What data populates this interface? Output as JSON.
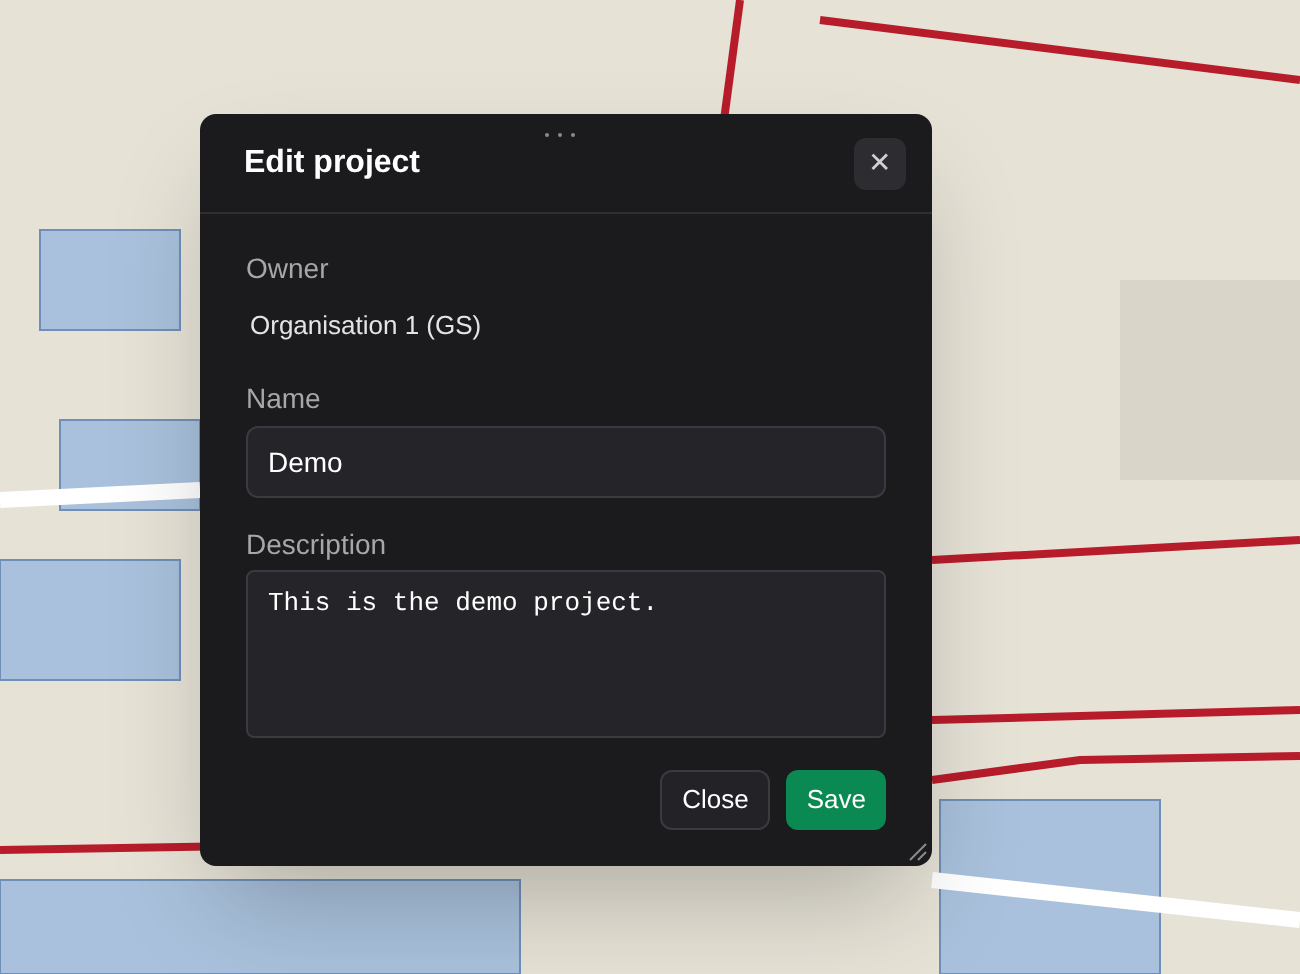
{
  "dialog": {
    "title": "Edit project",
    "close_icon": "✕",
    "owner": {
      "label": "Owner",
      "value": "Organisation 1 (GS)"
    },
    "name": {
      "label": "Name",
      "value": "Demo"
    },
    "description": {
      "label": "Description",
      "value": "This is the demo project."
    },
    "buttons": [
      {
        "label": "Close",
        "kind": "secondary"
      },
      {
        "label": "Save",
        "kind": "primary"
      }
    ]
  }
}
